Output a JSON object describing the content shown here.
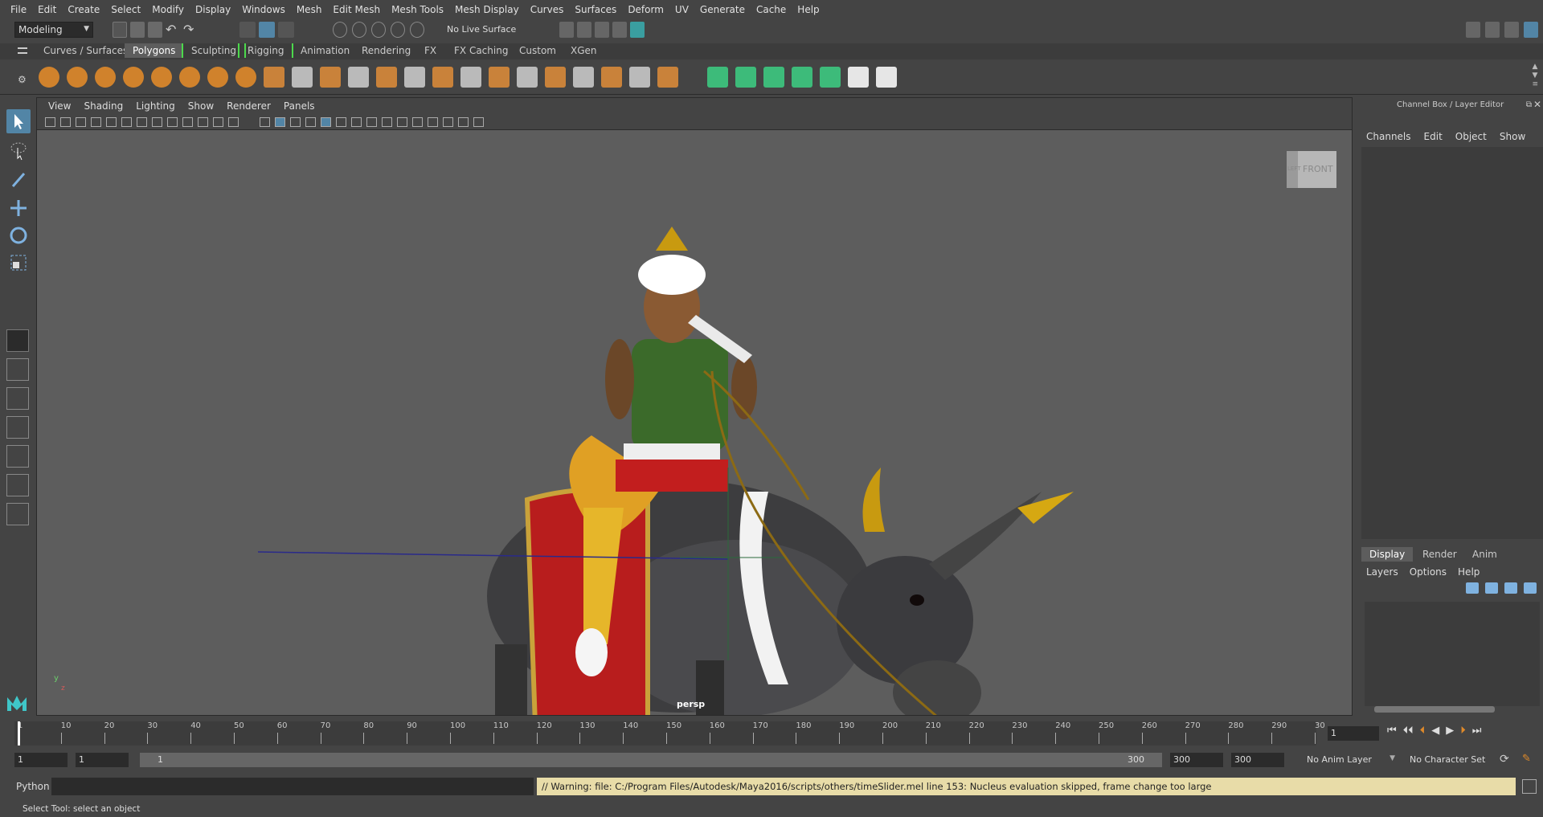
{
  "menubar": {
    "items": [
      "File",
      "Edit",
      "Create",
      "Select",
      "Modify",
      "Display",
      "Windows",
      "Mesh",
      "Edit Mesh",
      "Mesh Tools",
      "Mesh Display",
      "Curves",
      "Surfaces",
      "Deform",
      "UV",
      "Generate",
      "Cache",
      "Help"
    ]
  },
  "statusline": {
    "mode": "Modeling",
    "live_surface": "No Live Surface"
  },
  "shelf": {
    "tabs": [
      "Curves / Surfaces",
      "Polygons",
      "Sculpting",
      "Rigging",
      "Animation",
      "Rendering",
      "FX",
      "FX Caching",
      "Custom",
      "XGen"
    ],
    "active_tab": "Polygons"
  },
  "viewport": {
    "menu": [
      "View",
      "Shading",
      "Lighting",
      "Show",
      "Renderer",
      "Panels"
    ],
    "camera_label": "persp",
    "viewcube_left": "LEFT",
    "viewcube_front": "FRONT",
    "axis_y": "y",
    "axis_z": "z"
  },
  "channelbox": {
    "title": "Channel Box / Layer Editor",
    "menu": [
      "Channels",
      "Edit",
      "Object",
      "Show"
    ],
    "layer_tabs": [
      "Display",
      "Render",
      "Anim"
    ],
    "layer_menu": [
      "Layers",
      "Options",
      "Help"
    ]
  },
  "timeline": {
    "ticks": [
      "1",
      "10",
      "20",
      "30",
      "40",
      "50",
      "60",
      "70",
      "80",
      "90",
      "100",
      "110",
      "120",
      "130",
      "140",
      "150",
      "160",
      "170",
      "180",
      "190",
      "200",
      "210",
      "220",
      "230",
      "240",
      "250",
      "260",
      "270",
      "280",
      "290",
      "30"
    ],
    "current_frame": "1"
  },
  "range": {
    "start": "1",
    "playback_start": "1",
    "slider_start": "1",
    "slider_end": "300",
    "playback_end": "300",
    "end": "300",
    "anim_layer": "No Anim Layer",
    "character_set": "No Character Set"
  },
  "cmdline": {
    "language": "Python",
    "warning": "// Warning: file: C:/Program Files/Autodesk/Maya2016/scripts/others/timeSlider.mel line 153: Nucleus evaluation skipped, frame change too large"
  },
  "helpline": {
    "text": "Select Tool: select an object"
  },
  "colors": {
    "accent_blue": "#5285a6",
    "shelf_orange": "#e08a2a",
    "shelf_green": "#3dbb7a",
    "warning_bg": "#e8dca8"
  }
}
